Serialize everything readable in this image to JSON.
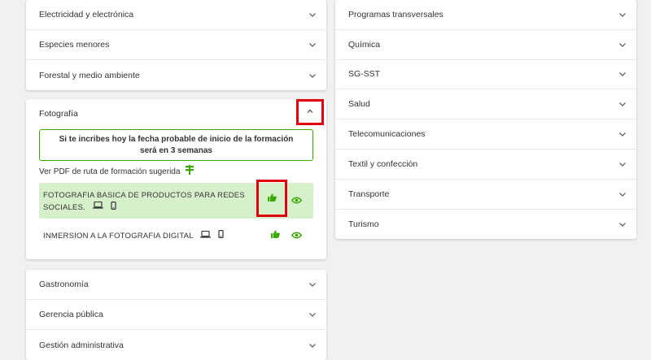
{
  "left_top": {
    "items": [
      {
        "label": "Electricidad y electrónica"
      },
      {
        "label": "Especies menores"
      },
      {
        "label": "Forestal y medio ambiente"
      }
    ]
  },
  "fotografia": {
    "title": "Fotografía",
    "notice": "Si te incribes hoy la fecha probable de inicio de la formación será en 3 semanas",
    "pdf_link": "Ver PDF de ruta de formación sugerida",
    "courses": [
      {
        "name": "FOTOGRAFIA BASICA DE PRODUCTOS PARA REDES SOCIALES.",
        "selected": true
      },
      {
        "name": "INMERSION A LA FOTOGRAFIA DIGITAL",
        "selected": false
      }
    ]
  },
  "left_bottom": {
    "items": [
      {
        "label": "Gastronomía"
      },
      {
        "label": "Gerencia pública"
      },
      {
        "label": "Gestión administrativa"
      }
    ]
  },
  "right": {
    "items": [
      {
        "label": "Programas transversales"
      },
      {
        "label": "Química"
      },
      {
        "label": "SG-SST"
      },
      {
        "label": "Salud"
      },
      {
        "label": "Telecomunicaciones"
      },
      {
        "label": "Textil y confección"
      },
      {
        "label": "Transporte"
      },
      {
        "label": "Turismo"
      }
    ]
  },
  "colors": {
    "accent_green": "#39a900",
    "highlight_bg": "#d7f0cc",
    "annotation_red": "#e1000f"
  },
  "icons": [
    "chevron-down-icon",
    "chevron-up-icon",
    "pdf-route-icon",
    "laptop-icon",
    "phone-icon",
    "thumbs-up-icon",
    "eye-icon"
  ]
}
